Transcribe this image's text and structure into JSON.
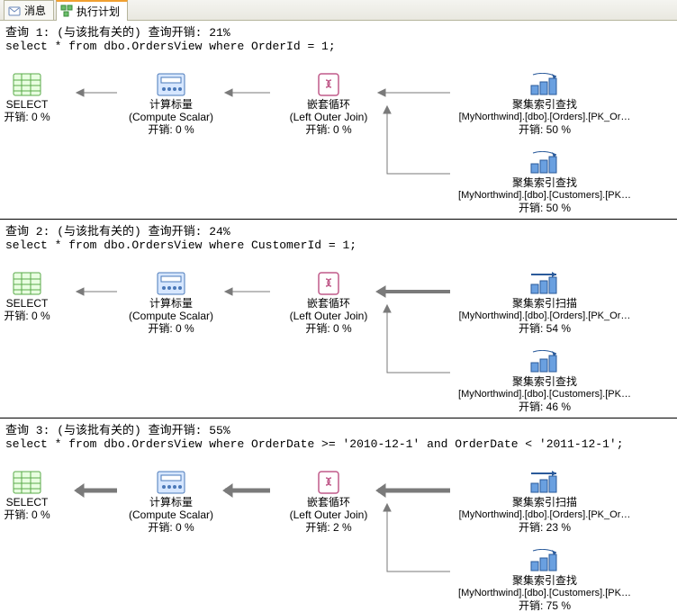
{
  "tabs": {
    "messages": "消息",
    "exec_plan": "执行计划"
  },
  "queries": [
    {
      "header": "查询 1: (与该批有关的) 查询开销: 21%",
      "sql": "select * from dbo.OrdersView where OrderId = 1;",
      "nodes": {
        "select_title": "SELECT",
        "select_cost": "开销: 0 %",
        "compute_title": "计算标量",
        "compute_sub": "(Compute Scalar)",
        "compute_cost": "开销: 0 %",
        "loop_title": "嵌套循环",
        "loop_sub": "(Left Outer Join)",
        "loop_cost": "开销: 0 %",
        "right1_title": "聚集索引查找",
        "right1_detail": "[MyNorthwind].[dbo].[Orders].[PK_Or…",
        "right1_cost": "开销: 50 %",
        "right2_title": "聚集索引查找",
        "right2_detail": "[MyNorthwind].[dbo].[Customers].[PK…",
        "right2_cost": "开销: 50 %"
      }
    },
    {
      "header": "查询 2: (与该批有关的) 查询开销: 24%",
      "sql": "select * from dbo.OrdersView where CustomerId = 1;",
      "nodes": {
        "select_title": "SELECT",
        "select_cost": "开销: 0 %",
        "compute_title": "计算标量",
        "compute_sub": "(Compute Scalar)",
        "compute_cost": "开销: 0 %",
        "loop_title": "嵌套循环",
        "loop_sub": "(Left Outer Join)",
        "loop_cost": "开销: 0 %",
        "right1_title": "聚集索引扫描",
        "right1_detail": "[MyNorthwind].[dbo].[Orders].[PK_Or…",
        "right1_cost": "开销: 54 %",
        "right2_title": "聚集索引查找",
        "right2_detail": "[MyNorthwind].[dbo].[Customers].[PK…",
        "right2_cost": "开销: 46 %"
      }
    },
    {
      "header": "查询 3: (与该批有关的) 查询开销: 55%",
      "sql": "select * from dbo.OrdersView where OrderDate >= '2010-12-1' and OrderDate < '2011-12-1';",
      "nodes": {
        "select_title": "SELECT",
        "select_cost": "开销: 0 %",
        "compute_title": "计算标量",
        "compute_sub": "(Compute Scalar)",
        "compute_cost": "开销: 0 %",
        "loop_title": "嵌套循环",
        "loop_sub": "(Left Outer Join)",
        "loop_cost": "开销: 2 %",
        "right1_title": "聚集索引扫描",
        "right1_detail": "[MyNorthwind].[dbo].[Orders].[PK_Or…",
        "right1_cost": "开销: 23 %",
        "right2_title": "聚集索引查找",
        "right2_detail": "[MyNorthwind].[dbo].[Customers].[PK…",
        "right2_cost": "开销: 75 %"
      }
    }
  ]
}
